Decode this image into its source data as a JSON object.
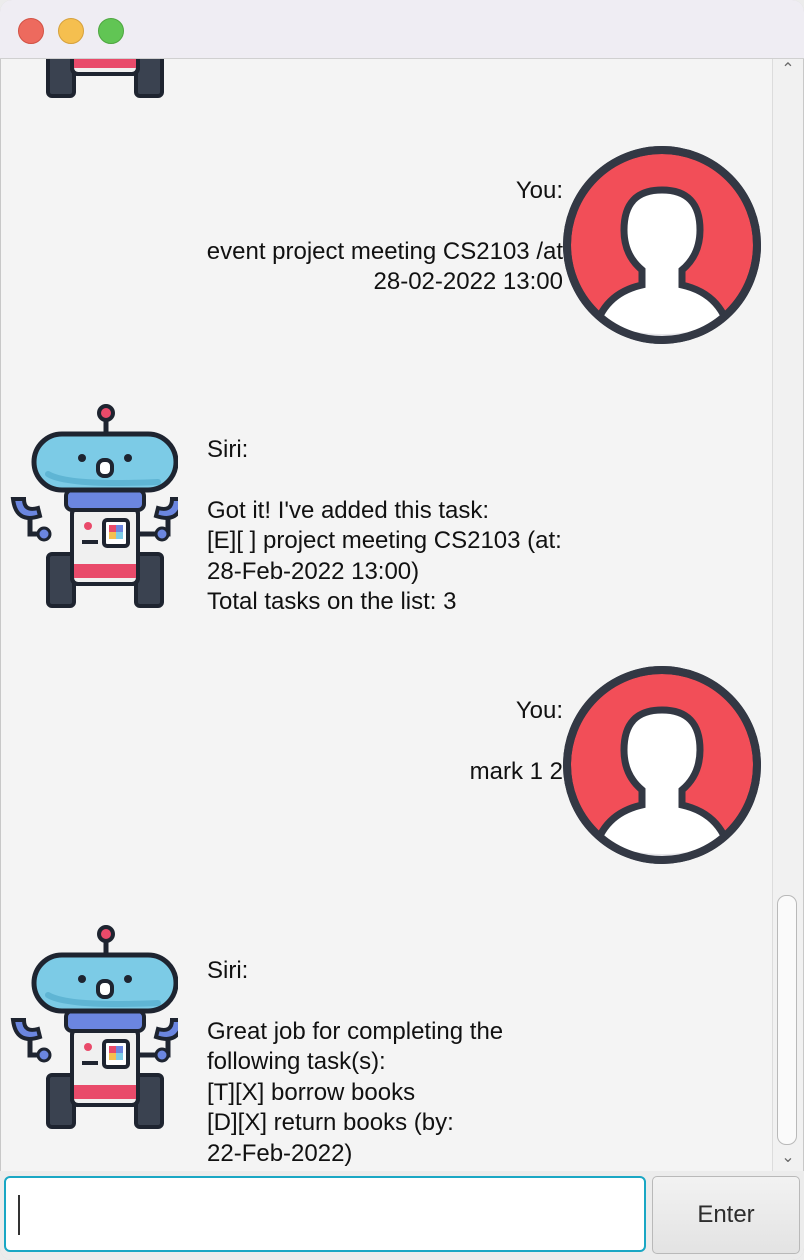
{
  "messages": [
    {
      "sender": "bot",
      "label": "",
      "text": ""
    },
    {
      "sender": "user",
      "label": "You:",
      "text": "event project meeting CS2103 /at\n28-02-2022 13:00"
    },
    {
      "sender": "bot",
      "label": "Siri:",
      "text": "Got it! I've added this task:\n[E][ ] project meeting CS2103 (at:\n28-Feb-2022 13:00)\nTotal tasks on the list: 3"
    },
    {
      "sender": "user",
      "label": "You:",
      "text": "mark 1 2"
    },
    {
      "sender": "bot",
      "label": "Siri:",
      "text": "Great job for completing the\nfollowing task(s):\n[T][X] borrow books\n[D][X] return books (by:\n22-Feb-2022)"
    }
  ],
  "input": {
    "value": "",
    "placeholder": ""
  },
  "enter_button": {
    "label": "Enter"
  },
  "colors": {
    "user_avatar": "#f24e58",
    "input_border": "#1aa7c4",
    "bot_head": "#7ccbe6",
    "bot_body": "#6b86e0"
  },
  "icons": {
    "user": "user-avatar-icon",
    "bot": "robot-avatar-icon"
  }
}
